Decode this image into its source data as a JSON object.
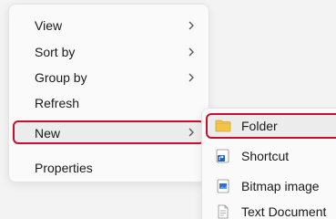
{
  "context_menu": {
    "items": [
      {
        "label": "View",
        "has_submenu": true
      },
      {
        "label": "Sort by",
        "has_submenu": true
      },
      {
        "label": "Group by",
        "has_submenu": true
      },
      {
        "label": "Refresh",
        "has_submenu": false
      },
      {
        "label": "New",
        "has_submenu": true,
        "highlighted": true
      },
      {
        "label": "Properties",
        "has_submenu": false
      }
    ]
  },
  "new_submenu": {
    "items": [
      {
        "label": "Folder",
        "icon": "folder-icon",
        "highlighted": true
      },
      {
        "label": "Shortcut",
        "icon": "shortcut-icon"
      },
      {
        "label": "Bitmap image",
        "icon": "bitmap-image-icon"
      },
      {
        "label": "Text Document",
        "icon": "text-document-icon"
      }
    ]
  },
  "colors": {
    "highlight_outline": "#c8102e",
    "menu_background": "#fafafa",
    "folder_yellow": "#f3c44b",
    "shortcut_blue": "#1f5fbf"
  }
}
